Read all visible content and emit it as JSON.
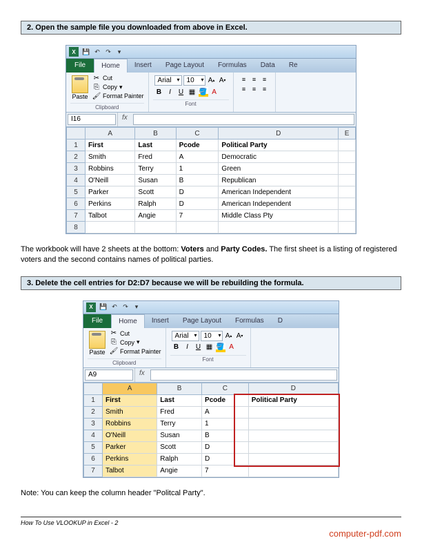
{
  "step2": {
    "title": "2. Open the sample file you downloaded from above in Excel."
  },
  "step3": {
    "title": "3. Delete the cell entries for D2:D7 because we will be rebuilding the formula."
  },
  "para1_pre": "The workbook will have 2 sheets at the bottom: ",
  "para1_b1": "Voters",
  "para1_mid": " and ",
  "para1_b2": "Party Codes.",
  "para1_post": " The first sheet is a listing of registered voters and the second contains names of political parties.",
  "note": "Note: You can keep the column header \"Politcal Party\".",
  "excel1": {
    "cell_ref": "I16",
    "tabs": {
      "file": "File",
      "home": "Home",
      "insert": "Insert",
      "pagelayout": "Page Layout",
      "formulas": "Formulas",
      "data": "Data",
      "re": "Re"
    },
    "clipboard": {
      "paste": "Paste",
      "cut": "Cut",
      "copy": "Copy",
      "format": "Format Painter",
      "label": "Clipboard"
    },
    "font": {
      "name": "Arial",
      "size": "10",
      "label": "Font",
      "b": "B",
      "i": "I",
      "u": "U"
    },
    "cols": [
      "",
      "A",
      "B",
      "C",
      "D",
      "E"
    ],
    "rows": [
      [
        "1",
        "First",
        "Last",
        "Pcode",
        "Political Party",
        ""
      ],
      [
        "2",
        "Smith",
        "Fred",
        "A",
        "Democratic",
        ""
      ],
      [
        "3",
        "Robbins",
        "Terry",
        "1",
        "Green",
        ""
      ],
      [
        "4",
        "O'Neill",
        "Susan",
        "B",
        "Republican",
        ""
      ],
      [
        "5",
        "Parker",
        "Scott",
        "D",
        "American Independent",
        ""
      ],
      [
        "6",
        "Perkins",
        "Ralph",
        "D",
        "American Independent",
        ""
      ],
      [
        "7",
        "Talbot",
        "Angie",
        "7",
        "Middle Class Pty",
        ""
      ],
      [
        "8",
        "",
        "",
        "",
        "",
        ""
      ]
    ]
  },
  "excel2": {
    "cell_ref": "A9",
    "tabs": {
      "file": "File",
      "home": "Home",
      "insert": "Insert",
      "pagelayout": "Page Layout",
      "formulas": "Formulas",
      "d": "D"
    },
    "clipboard": {
      "paste": "Paste",
      "cut": "Cut",
      "copy": "Copy",
      "format": "Format Painter",
      "label": "Clipboard"
    },
    "font": {
      "name": "Arial",
      "size": "10",
      "label": "Font",
      "b": "B",
      "i": "I",
      "u": "U"
    },
    "cols": [
      "",
      "A",
      "B",
      "C",
      "D"
    ],
    "rows": [
      [
        "1",
        "First",
        "Last",
        "Pcode",
        "Political Party"
      ],
      [
        "2",
        "Smith",
        "Fred",
        "A",
        ""
      ],
      [
        "3",
        "Robbins",
        "Terry",
        "1",
        ""
      ],
      [
        "4",
        "O'Neill",
        "Susan",
        "B",
        ""
      ],
      [
        "5",
        "Parker",
        "Scott",
        "D",
        ""
      ],
      [
        "6",
        "Perkins",
        "Ralph",
        "D",
        ""
      ],
      [
        "7",
        "Talbot",
        "Angie",
        "7",
        ""
      ]
    ]
  },
  "footer": {
    "left": "How To Use VLOOKUP in Excel  - 2",
    "right": ""
  },
  "watermark": "computer-pdf.com"
}
